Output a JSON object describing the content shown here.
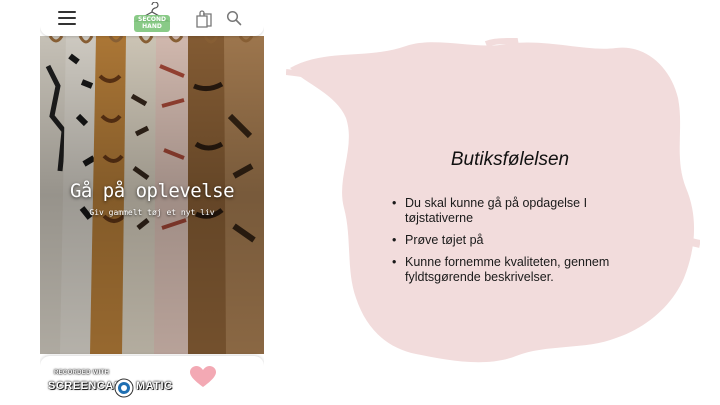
{
  "app": {
    "logo_text_line1": "SECOND",
    "logo_text_line2": "HAND"
  },
  "hero": {
    "title": "Gå på oplevelse",
    "subtitle": "Giv gammelt tøj et nyt liv"
  },
  "watermark": {
    "recorded_with": "RECORDED WITH",
    "brand_left": "SCREENCAST",
    "brand_right": "MATIC"
  },
  "slide": {
    "title": "Butiksfølelsen",
    "bullets": [
      "Du skal kunne gå på opdagelse I tøjstativerne",
      "Prøve tøjet på",
      "Kunne fornemme kvaliteten, gennem fyldtsgørende beskrivelser."
    ]
  },
  "icons": {
    "menu": "hamburger-menu-icon",
    "logo": "hanger-logo",
    "bag": "shopping-bag-icon",
    "search": "search-icon",
    "heart": "heart-icon"
  },
  "colors": {
    "blob": "#f2dcdc",
    "heart": "#f3a9b4",
    "logo_green": "#7cc47a"
  }
}
